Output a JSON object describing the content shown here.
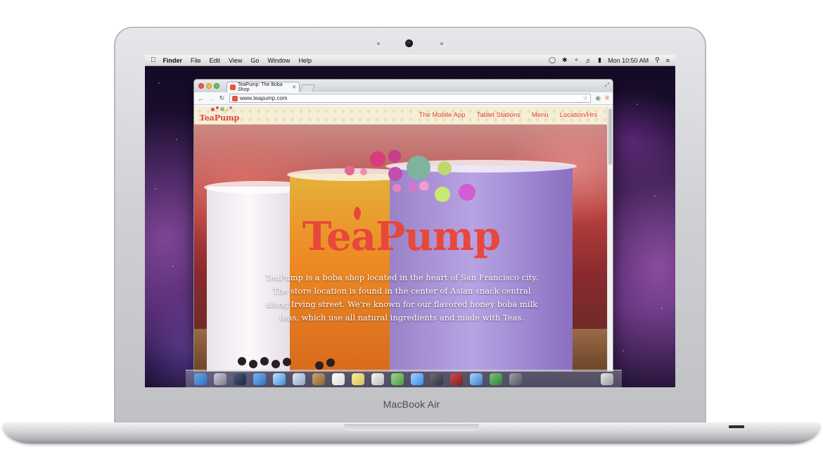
{
  "device": {
    "label": "MacBook Air"
  },
  "menubar": {
    "app_name": "Finder",
    "items": [
      "File",
      "Edit",
      "View",
      "Go",
      "Window",
      "Help"
    ],
    "clock": "Mon 10:50 AM",
    "status_icons": [
      "chat-icon",
      "bluetooth-icon",
      "wifi-icon",
      "volume-icon",
      "battery-icon",
      "search-icon",
      "list-icon"
    ]
  },
  "browser": {
    "tab_title": "TeaPump: The Boba Shop",
    "url": "www.teapump.com"
  },
  "site": {
    "logo_text": "TeaPump",
    "nav": [
      "The Mobile App",
      "Tablet Stations",
      "Menu",
      "Location/Hrs"
    ],
    "hero_title": "TeaPump",
    "hero_description": "TeaPump is a boba shop located in the heart of San Francisco city. The store location is found in the center of Asian snack central along Irving street. We're known for our flavored honey boba milk teas, which use all natural ingredients and made with Teas."
  },
  "colors": {
    "brand_red": "#e8473c",
    "nav_text": "#e0442f",
    "header_bg": "#f6efd8"
  },
  "dock": {
    "icons": [
      "finder-icon",
      "launchpad-icon",
      "mission-control-icon",
      "app-store-icon",
      "safari-icon",
      "mail-icon",
      "contacts-icon",
      "calendar-icon",
      "notes-icon",
      "reminders-icon",
      "maps-icon",
      "messages-icon",
      "facetime-icon",
      "photo-booth-icon",
      "itunes-icon",
      "photos-icon",
      "preferences-icon",
      "trash-icon"
    ]
  }
}
